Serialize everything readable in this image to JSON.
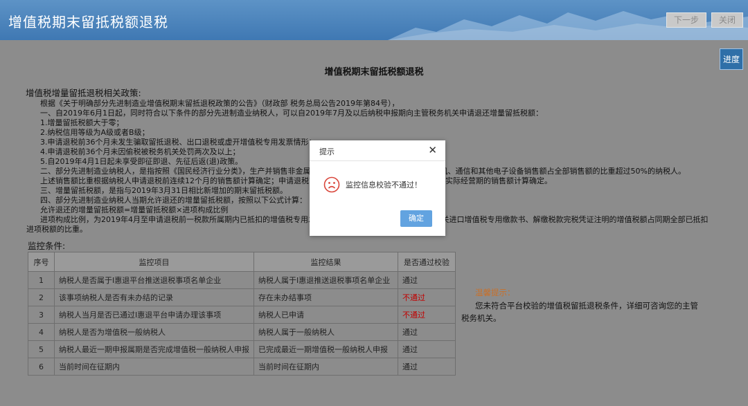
{
  "header": {
    "title": "增值税期末留抵税额退税",
    "next_label": "下一步",
    "close_label": "关闭"
  },
  "progress_label": "进度",
  "main_title": "增值税期末留抵税额退税",
  "policy": {
    "section_title": "增值税增量留抵退税相关政策:",
    "lines": [
      "根据《关于明确部分先进制造业增值税期末留抵退税政策的公告》（财政部 税务总局公告2019年第84号），",
      "一、自2019年6月1日起，同时符合以下条件的部分先进制造业纳税人，可以自2019年7月及以后纳税申报期向主管税务机关申请退还增量留抵税额：",
      "1.增量留抵税额大于零；",
      "2.纳税信用等级为A级或者B级；",
      "3.申请退税前36个月未发生骗取留抵退税、出口退税或虚开增值税专用发票情形；",
      "4.申请退税前36个月未因偷税被税务机关处罚两次及以上；",
      "5.自2019年4月1日起未享受即征即退、先征后返(退)政策。",
      "二、部分先进制造业纳税人，是指按照《国民经济行业分类》，生产并销售非金属矿物制品、通用设备、专用设备及计算机、通信和其他电子设备销售额占全部销售额的比重超过50%的纳税人。",
      "上述销售额比重根据纳税人申请退税前连续12个月的销售额计算确定；申请退税前经营期不满12个月但满3个月的，按照实际经营期的销售额计算确定。",
      "三、增量留抵税额，是指与2019年3月31日相比新增加的期末留抵税额。",
      "四、部分先进制造业纳税人当期允许退还的增量留抵税额，按照以下公式计算：",
      "允许退还的增量留抵税额=增量留抵税额×进项构成比例",
      "进项构成比例，为2019年4月至申请退税前一税款所属期内已抵扣的增值税专用发票（含税控机动车销售统一发票）、海关进口增值税专用缴款书、解缴税款完税凭证注明的增值税额占同期全部已抵扣",
      "进项税额的比重。"
    ]
  },
  "monitor": {
    "title": "监控条件:",
    "headers": [
      "序号",
      "监控项目",
      "监控结果",
      "是否通过校验"
    ],
    "rows": [
      {
        "no": "1",
        "item": "纳税人是否属于I惠退平台推送退税事项名单企业",
        "result": "纳税人属于I惠退推送退税事项名单企业",
        "status": "通过",
        "fail": false
      },
      {
        "no": "2",
        "item": "该事项纳税人是否有未办结的记录",
        "result": "存在未办结事项",
        "status": "不通过",
        "fail": true
      },
      {
        "no": "3",
        "item": "纳税人当月是否已通过I惠退平台申请办理该事项",
        "result": "纳税人已申请",
        "status": "不通过",
        "fail": true
      },
      {
        "no": "4",
        "item": "纳税人是否为增值税一般纳税人",
        "result": "纳税人属于一般纳税人",
        "status": "通过",
        "fail": false
      },
      {
        "no": "5",
        "item": "纳税人最近一期申报属期是否完成增值税一般纳税人申报",
        "result": "已完成最近一期增值税一般纳税人申报",
        "status": "通过",
        "fail": false
      },
      {
        "no": "6",
        "item": "当前时间在征期内",
        "result": "当前时间在征期内",
        "status": "通过",
        "fail": false
      }
    ]
  },
  "tip": {
    "title": "温馨提示：",
    "body": "您未符合平台校验的增值税留抵退税条件，详细可咨询您的主管税务机关。"
  },
  "modal": {
    "title": "提示",
    "close_glyph": "✕",
    "message": "监控信息校验不通过！",
    "icon": "sad-face-icon",
    "ok_label": "确定"
  },
  "colors": {
    "header_bg": "#4a86c0",
    "fail_text": "#c10000",
    "ok_button": "#62a3e0",
    "tip_title": "#c8702a"
  }
}
